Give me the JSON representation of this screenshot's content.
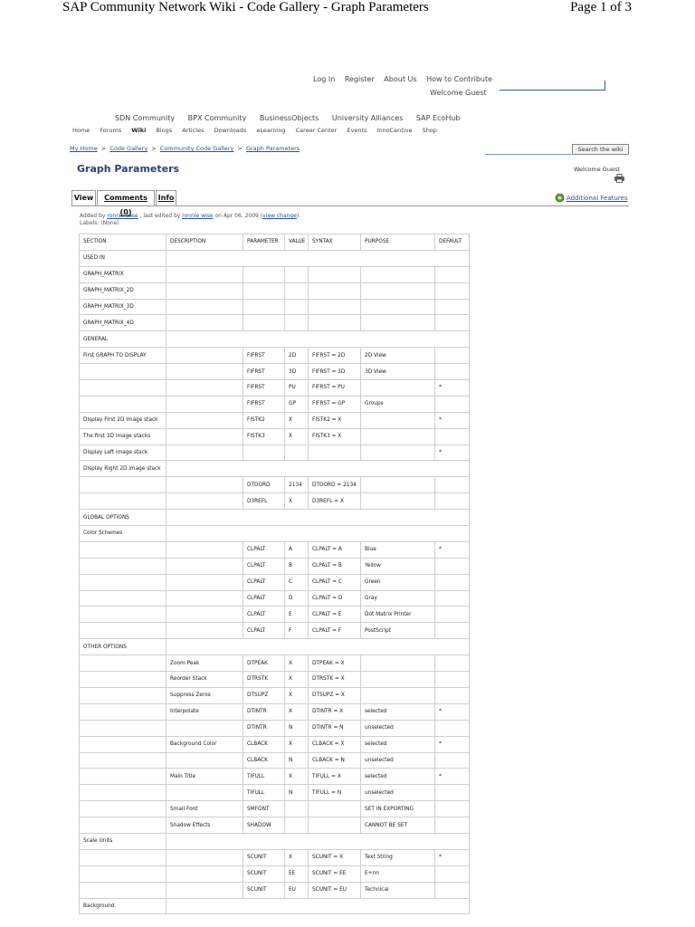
{
  "pdf_header": {
    "title": "SAP Community Network Wiki - Code Gallery - Graph Parameters",
    "page": "Page 1 of 3"
  },
  "top_links": [
    "Log In",
    "Register",
    "About Us",
    "How to Contribute"
  ],
  "welcome_top": "Welcome Guest",
  "communities": [
    "SDN Community",
    "BPX Community",
    "BusinessObjects",
    "University Alliances",
    "SAP EcoHub"
  ],
  "main_nav": [
    "Home",
    "Forums",
    "Wiki",
    "Blogs",
    "Articles",
    "Downloads",
    "eLearning",
    "Career Center",
    "Events",
    "InnoCentive",
    "Shop"
  ],
  "main_nav_active": "Wiki",
  "breadcrumb": [
    "My Home",
    "Code Gallery",
    "Community Code Gallery",
    "Graph Parameters"
  ],
  "breadcrumb_sep": ">",
  "search_button": "Search the wiki",
  "page_title": "Graph Parameters",
  "welcome_guest": "Welcome Guest",
  "tabs": {
    "view": "View",
    "comments": "Comments (0)",
    "info": "Info"
  },
  "additional_features": "Additional Features",
  "meta": {
    "added_by": "Added by",
    "author": "ronnie wise",
    "last_edited_by": ", last edited by",
    "editor": "ronnie wise",
    "on_date": "on Apr 06, 2009",
    "view_change": "view change",
    "labels": "Labels: (None)"
  },
  "table": {
    "header": [
      "SECTION",
      "DESCRIPTION",
      "PARAMETER",
      "VALUE",
      "SYNTAX",
      "PURPOSE",
      "DEFAULT"
    ],
    "rows": [
      [
        "USED IN"
      ],
      [
        "GRAPH_MATRIX",
        "",
        "",
        "",
        "",
        "",
        ""
      ],
      [
        "GRAPH_MATRIX_2D",
        "",
        "",
        "",
        "",
        "",
        ""
      ],
      [
        "GRAPH_MATRIX_3D",
        "",
        "",
        "",
        "",
        "",
        ""
      ],
      [
        "GRAPH_MATRIX_4D",
        "",
        "",
        "",
        "",
        "",
        ""
      ],
      [
        "GENERAL"
      ],
      [
        "First GRAPH TO DISPLAY",
        "",
        "FIFRST",
        "2D",
        "FIFRST = 2D",
        "2D View",
        ""
      ],
      [
        "",
        "",
        "FIFRST",
        "3D",
        "FIFRST = 3D",
        "3D View",
        ""
      ],
      [
        "",
        "",
        "FIFRST",
        "PU",
        "FIFRST = PU",
        "",
        "*"
      ],
      [
        "",
        "",
        "FIFRST",
        "GP",
        "FIFRST = GP",
        "Groups",
        ""
      ],
      [
        "Display First 2D image stack",
        "",
        "FISTK2",
        "X",
        "FISTK2 = X",
        "",
        "*"
      ],
      [
        "The first 3D image stacks",
        "",
        "FISTK3",
        "X",
        "FISTK3 = X",
        "",
        ""
      ],
      [
        "Display Left image stack",
        "",
        "",
        "",
        "",
        "",
        "*"
      ],
      [
        "Display Right 2D image stack"
      ],
      [
        "",
        "",
        "DTDORD",
        "2134",
        "DTDORD = 2134",
        "",
        ""
      ],
      [
        "",
        "",
        "D3REFL",
        "X",
        "D3REFL = X",
        "",
        ""
      ],
      [
        "GLOBAL OPTIONS"
      ],
      [
        "Color Schemes"
      ],
      [
        "",
        "",
        "CLPALT",
        "A",
        "CLPALT = A",
        "Blue",
        "*"
      ],
      [
        "",
        "",
        "CLPALT",
        "B",
        "CLPALT = B",
        "Yellow",
        ""
      ],
      [
        "",
        "",
        "CLPALT",
        "C",
        "CLPALT = C",
        "Green",
        ""
      ],
      [
        "",
        "",
        "CLPALT",
        "D",
        "CLPALT = D",
        "Gray",
        ""
      ],
      [
        "",
        "",
        "CLPALT",
        "E",
        "CLPALT = E",
        "Dot Matrix Printer",
        ""
      ],
      [
        "",
        "",
        "CLPALT",
        "F",
        "CLPALT = F",
        "PostScript",
        ""
      ],
      [
        "OTHER OPTIONS"
      ],
      [
        "",
        "Zoom Peak",
        "DTPEAK",
        "X",
        "DTPEAK = X",
        "",
        ""
      ],
      [
        "",
        "Reorder Stack",
        "DTRSTK",
        "X",
        "DTRSTK = X",
        "",
        ""
      ],
      [
        "",
        "Suppress Zeros",
        "DTSUPZ",
        "X",
        "DTSUPZ = X",
        "",
        ""
      ],
      [
        "",
        "Interpolate",
        "DTINTR",
        "X",
        "DTINTR = X",
        "selected",
        "*"
      ],
      [
        "",
        "",
        "DTINTR",
        "N",
        "DTINTR = N",
        "unselected",
        ""
      ],
      [
        "",
        "Background Color",
        "CLBACK",
        "X",
        "CLBACK = X",
        "selected",
        "*"
      ],
      [
        "",
        "",
        "CLBACK",
        "N",
        "CLBACK = N",
        "unselected",
        ""
      ],
      [
        "",
        "Main Title",
        "TIFULL",
        "X",
        "TIFULL = X",
        "selected",
        "*"
      ],
      [
        "",
        "",
        "TIFULL",
        "N",
        "TIFULL = N",
        "unselected",
        ""
      ],
      [
        "",
        "Small Font",
        "SMFONT",
        "",
        "",
        "SET IN EXPORTING",
        ""
      ],
      [
        "",
        "Shadow Effects",
        "SHADOW",
        "",
        "",
        "CANNOT BE SET",
        ""
      ],
      [
        "Scale Units"
      ],
      [
        "",
        "",
        "SCUNIT",
        "X",
        "SCUNIT = X",
        "Text String",
        "*"
      ],
      [
        "",
        "",
        "SCUNIT",
        "EE",
        "SCUNIT = EE",
        "E+nn",
        ""
      ],
      [
        "",
        "",
        "SCUNIT",
        "EU",
        "SCUNIT = EU",
        "Technical",
        ""
      ],
      [
        "Background"
      ]
    ]
  }
}
